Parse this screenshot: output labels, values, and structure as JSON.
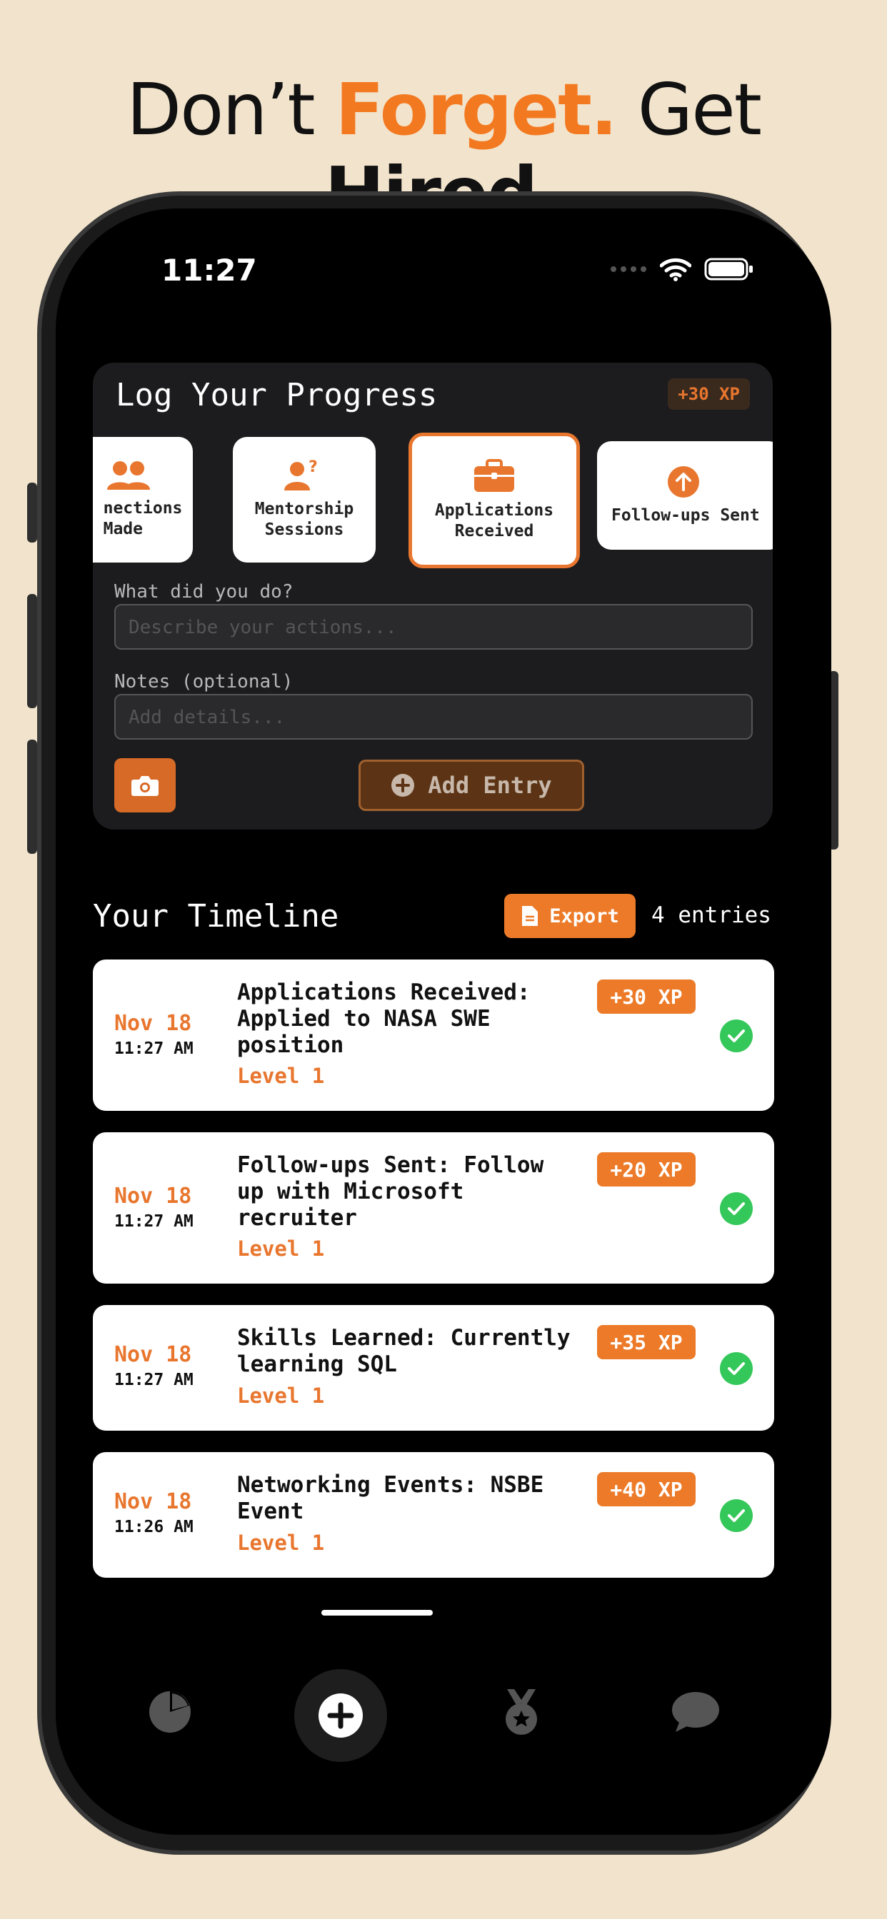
{
  "headline": {
    "w1": "Don’t",
    "w2": "Forget.",
    "w3": "Get",
    "w4": "Hired."
  },
  "status": {
    "time": "11:27"
  },
  "log": {
    "title": "Log Your Progress",
    "xp": "+30 XP",
    "categories": [
      {
        "label": "nections Made",
        "line1": "nections",
        "line2": "Made",
        "icon": "people-icon"
      },
      {
        "label": "Mentorship Sessions",
        "line1": "Mentorship",
        "line2": "Sessions",
        "icon": "person-question-icon"
      },
      {
        "label": "Applications Received",
        "line1": "Applications",
        "line2": "Received",
        "icon": "briefcase-icon",
        "selected": true
      },
      {
        "label": "Follow-ups Sent",
        "line1": "Follow-ups Sent",
        "line2": "",
        "icon": "arrow-up-circle-icon"
      }
    ],
    "what_label": "What did you do?",
    "what_placeholder": "Describe your actions...",
    "notes_label": "Notes (optional)",
    "notes_placeholder": "Add details...",
    "add_label": "Add Entry"
  },
  "timeline": {
    "title": "Your Timeline",
    "export_label": "Export",
    "count": "4 entries",
    "entries": [
      {
        "date": "Nov 18",
        "time": "11:27 AM",
        "text": "Applications Received: Applied to NASA SWE position",
        "level": "Level 1",
        "xp": "+30 XP"
      },
      {
        "date": "Nov 18",
        "time": "11:27 AM",
        "text": "Follow-ups Sent: Follow up with Microsoft recruiter",
        "level": "Level 1",
        "xp": "+20 XP"
      },
      {
        "date": "Nov 18",
        "time": "11:27 AM",
        "text": "Skills Learned: Currently learning SQL",
        "level": "Level 1",
        "xp": "+35 XP"
      },
      {
        "date": "Nov 18",
        "time": "11:26 AM",
        "text": "Networking Events: NSBE Event",
        "level": "Level 1",
        "xp": "+40 XP"
      }
    ]
  },
  "tabs": [
    "pie-chart-icon",
    "plus-circle-icon",
    "medal-icon",
    "chat-bubble-icon"
  ],
  "colors": {
    "accent": "#ec7a28",
    "background": "#f2e4cc",
    "success": "#34c759"
  }
}
